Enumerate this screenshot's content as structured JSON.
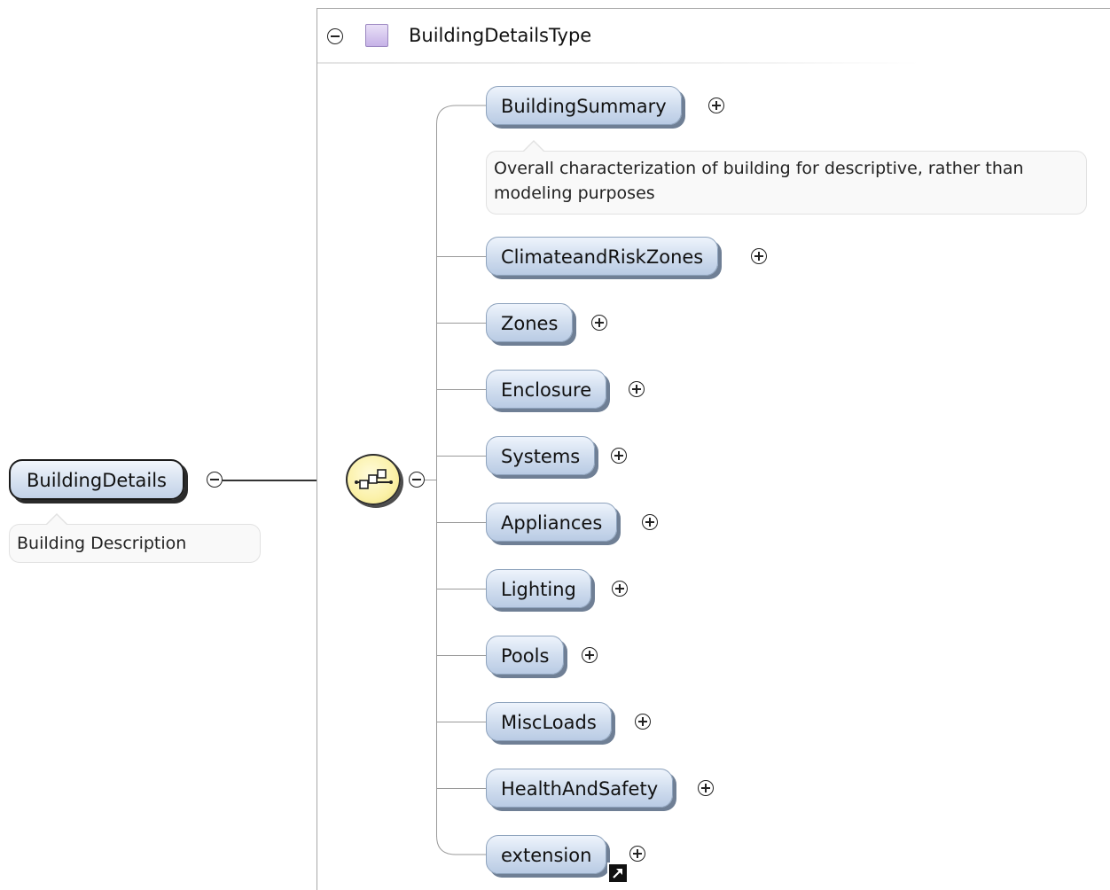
{
  "root": {
    "name": "BuildingDetails",
    "annotation": "Building Description"
  },
  "type": {
    "name": "BuildingDetailsType"
  },
  "compositor": {
    "kind": "sequence",
    "icon": "sequence-icon"
  },
  "elements": [
    {
      "name": "BuildingSummary",
      "annotation": "Overall characterization of building for descriptive, rather than modeling purposes"
    },
    {
      "name": "ClimateandRiskZones"
    },
    {
      "name": "Zones"
    },
    {
      "name": "Enclosure"
    },
    {
      "name": "Systems"
    },
    {
      "name": "Appliances"
    },
    {
      "name": "Lighting"
    },
    {
      "name": "Pools"
    },
    {
      "name": "MiscLoads"
    },
    {
      "name": "HealthAndSafety"
    },
    {
      "name": "extension",
      "reference": true
    }
  ],
  "colors": {
    "element_fill": "#cfdcee",
    "type_swatch": "#c6b2e7",
    "compositor_fill": "#fbf1a8"
  }
}
